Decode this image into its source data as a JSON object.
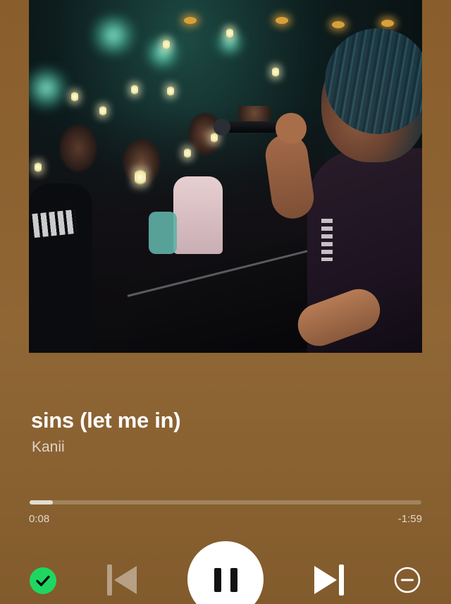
{
  "player": {
    "track_title": "sins (let me in)",
    "artist": "Kanii",
    "elapsed": "0:08",
    "remaining": "-1:59",
    "progress_fraction": 0.06,
    "is_playing": true,
    "is_saved": true
  },
  "album_art": {
    "icon": "album-cover-image"
  },
  "controls": {
    "saved_icon": "check-circle-icon",
    "previous_icon": "skip-previous-icon",
    "pause_icon": "pause-icon",
    "next_icon": "skip-next-icon",
    "remove_icon": "minus-circle-icon"
  },
  "colors": {
    "background": "#8d6231",
    "accent_green": "#1ed760",
    "progress_track": "rgba(255,255,255,0.22)",
    "progress_fill": "rgba(255,255,255,0.72)"
  }
}
